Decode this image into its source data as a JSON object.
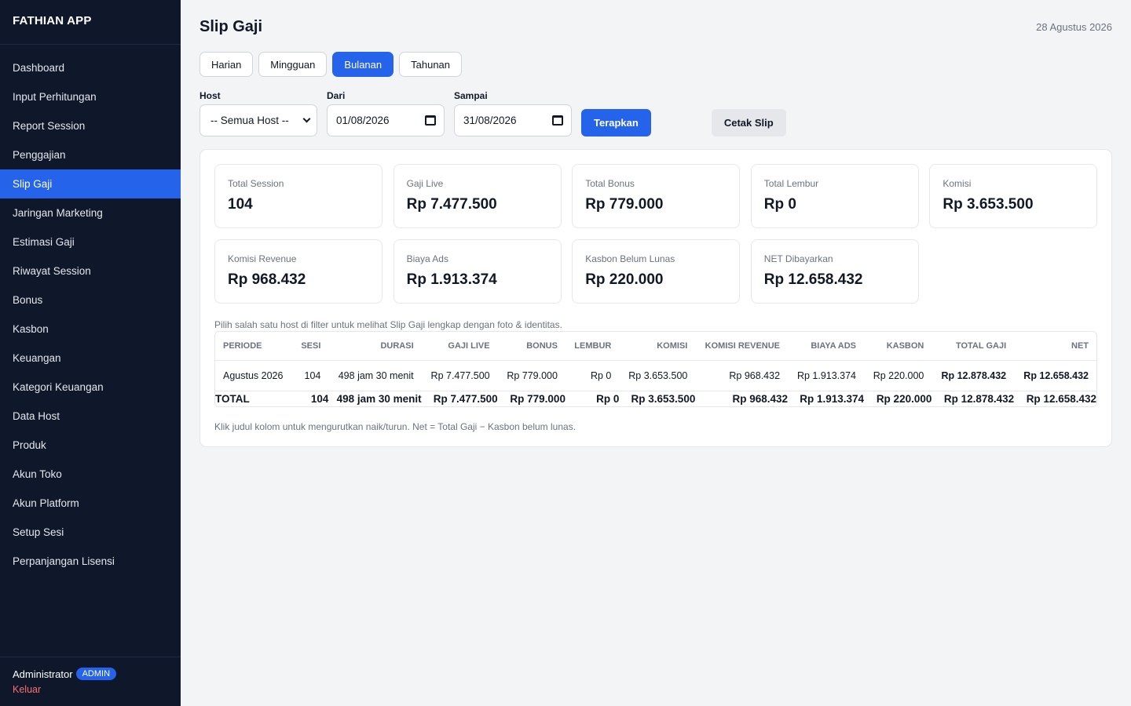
{
  "app": {
    "title": "FATHIAN APP"
  },
  "sidebar": {
    "items": [
      {
        "label": "Dashboard",
        "active": false
      },
      {
        "label": "Input Perhitungan",
        "active": false
      },
      {
        "label": "Report Session",
        "active": false
      },
      {
        "label": "Penggajian",
        "active": false
      },
      {
        "label": "Slip Gaji",
        "active": true
      },
      {
        "label": "Jaringan Marketing",
        "active": false
      },
      {
        "label": "Estimasi Gaji",
        "active": false
      },
      {
        "label": "Riwayat Session",
        "active": false
      },
      {
        "label": "Bonus",
        "active": false
      },
      {
        "label": "Kasbon",
        "active": false
      },
      {
        "label": "Keuangan",
        "active": false
      },
      {
        "label": "Kategori Keuangan",
        "active": false
      },
      {
        "label": "Data Host",
        "active": false
      },
      {
        "label": "Produk",
        "active": false
      },
      {
        "label": "Akun Toko",
        "active": false
      },
      {
        "label": "Akun Platform",
        "active": false
      },
      {
        "label": "Setup Sesi",
        "active": false
      },
      {
        "label": "Perpanjangan Lisensi",
        "active": false
      }
    ],
    "user": {
      "name": "Administrator",
      "role": "ADMIN",
      "logout": "Keluar"
    }
  },
  "header": {
    "title": "Slip Gaji",
    "date": "28 Agustus 2026"
  },
  "tabs": [
    {
      "label": "Harian",
      "active": false
    },
    {
      "label": "Mingguan",
      "active": false
    },
    {
      "label": "Bulanan",
      "active": true
    },
    {
      "label": "Tahunan",
      "active": false
    }
  ],
  "filters": {
    "host_label": "Host",
    "host_value": "-- Semua Host --",
    "from_label": "Dari",
    "from_value": "01/08/2026",
    "to_label": "Sampai",
    "to_value": "31/08/2026",
    "apply_label": "Terapkan",
    "print_label": "Cetak Slip"
  },
  "stats": [
    {
      "label": "Total Session",
      "value": "104"
    },
    {
      "label": "Gaji Live",
      "value": "Rp 7.477.500"
    },
    {
      "label": "Total Bonus",
      "value": "Rp 779.000"
    },
    {
      "label": "Total Lembur",
      "value": "Rp 0"
    },
    {
      "label": "Komisi",
      "value": "Rp 3.653.500"
    },
    {
      "label": "Komisi Revenue",
      "value": "Rp 968.432"
    },
    {
      "label": "Biaya Ads",
      "value": "Rp 1.913.374"
    },
    {
      "label": "Kasbon Belum Lunas",
      "value": "Rp 220.000"
    },
    {
      "label": "NET Dibayarkan",
      "value": "Rp 12.658.432"
    }
  ],
  "hint": "Pilih salah satu host di filter untuk melihat Slip Gaji lengkap dengan foto & identitas.",
  "table": {
    "columns": [
      "PERIODE",
      "SESI",
      "DURASI",
      "GAJI LIVE",
      "BONUS",
      "LEMBUR",
      "KOMISI",
      "KOMISI REVENUE",
      "BIAYA ADS",
      "KASBON",
      "TOTAL GAJI",
      "NET"
    ],
    "rows": [
      [
        "Agustus 2026",
        "104",
        "498 jam 30 menit",
        "Rp 7.477.500",
        "Rp 779.000",
        "Rp 0",
        "Rp 3.653.500",
        "Rp 968.432",
        "Rp 1.913.374",
        "Rp 220.000",
        "Rp 12.878.432",
        "Rp 12.658.432"
      ]
    ],
    "total": [
      "TOTAL",
      "104",
      "498 jam 30 menit",
      "Rp 7.477.500",
      "Rp 779.000",
      "Rp 0",
      "Rp 3.653.500",
      "Rp 968.432",
      "Rp 1.913.374",
      "Rp 220.000",
      "Rp 12.878.432",
      "Rp 12.658.432"
    ]
  },
  "note": "Klik judul kolom untuk mengurutkan naik/turun. Net = Total Gaji − Kasbon belum lunas.",
  "colors": {
    "sidebar_bg": "#0f172a",
    "accent": "#2563eb",
    "logout": "#f87171"
  }
}
